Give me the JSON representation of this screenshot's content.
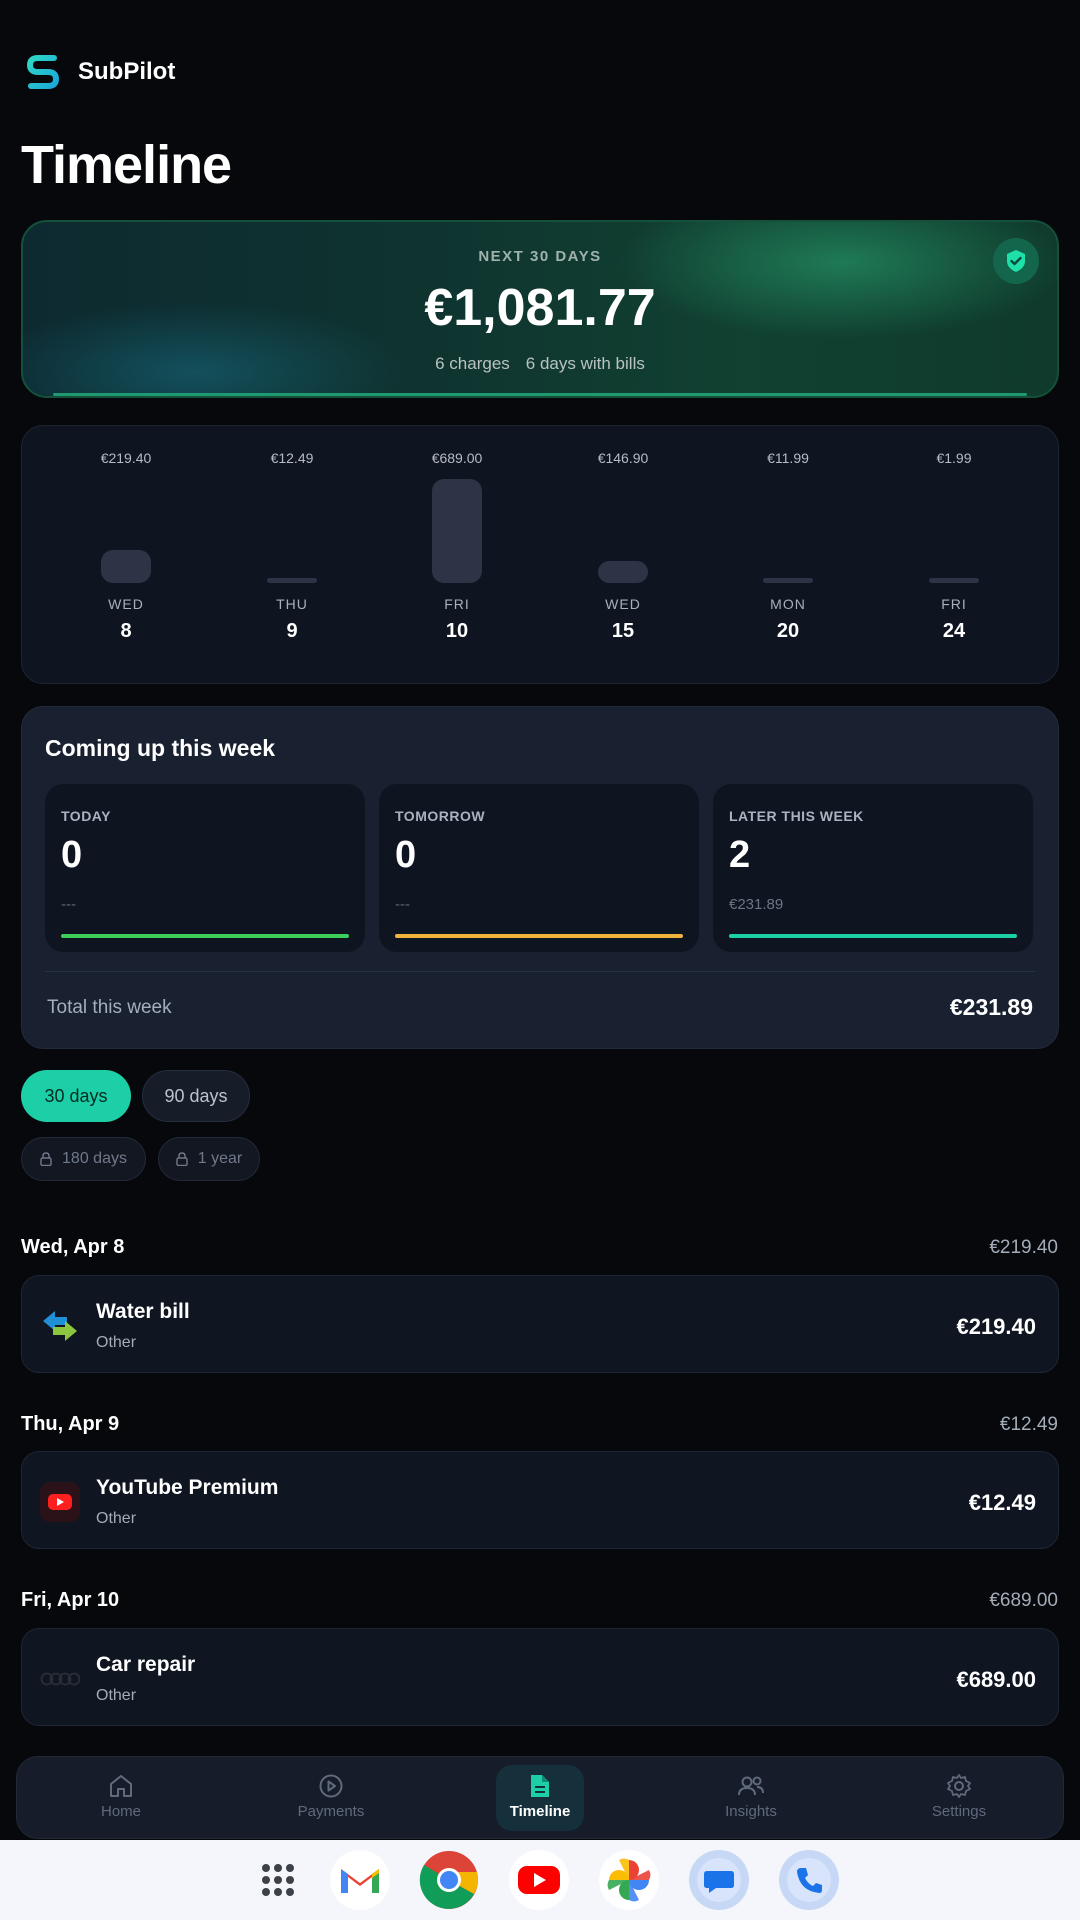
{
  "app": {
    "name": "SubPilot"
  },
  "page": {
    "title": "Timeline"
  },
  "summary": {
    "label": "NEXT 30 DAYS",
    "amount": "€1,081.77",
    "charges": "6 charges",
    "days_with_bills": "6 days with bills"
  },
  "chart_data": {
    "type": "bar",
    "categories": [
      "WED 8",
      "THU 9",
      "FRI 10",
      "WED 15",
      "MON 20",
      "FRI 24"
    ],
    "values": [
      219.4,
      12.49,
      689.0,
      146.9,
      11.99,
      1.99
    ],
    "bars": [
      {
        "label": "€219.40",
        "day": "WED",
        "date": "8",
        "value": 219.4
      },
      {
        "label": "€12.49",
        "day": "THU",
        "date": "9",
        "value": 12.49
      },
      {
        "label": "€689.00",
        "day": "FRI",
        "date": "10",
        "value": 689.0
      },
      {
        "label": "€146.90",
        "day": "WED",
        "date": "15",
        "value": 146.9
      },
      {
        "label": "€11.99",
        "day": "MON",
        "date": "20",
        "value": 11.99
      },
      {
        "label": "€1.99",
        "day": "FRI",
        "date": "24",
        "value": 1.99
      }
    ]
  },
  "week": {
    "title": "Coming up this week",
    "cards": [
      {
        "label": "TODAY",
        "count": "0",
        "sub": "---",
        "color": "#3ccf5a"
      },
      {
        "label": "TOMORROW",
        "count": "0",
        "sub": "---",
        "color": "#f0b33e"
      },
      {
        "label": "LATER THIS WEEK",
        "count": "2",
        "sub": "€231.89",
        "color": "#1ccfa6"
      }
    ],
    "total_label": "Total this week",
    "total_value": "€231.89"
  },
  "ranges": {
    "d30": "30 days",
    "d90": "90 days",
    "d180": "180 days",
    "y1": "1 year"
  },
  "groups": [
    {
      "date": "Wed, Apr 8",
      "total": "€219.40",
      "item": {
        "name": "Water bill",
        "category": "Other",
        "amount": "€219.40",
        "icon": "water-bill-icon"
      }
    },
    {
      "date": "Thu, Apr 9",
      "total": "€12.49",
      "item": {
        "name": "YouTube Premium",
        "category": "Other",
        "amount": "€12.49",
        "icon": "youtube-icon"
      }
    },
    {
      "date": "Fri, Apr 10",
      "total": "€689.00",
      "item": {
        "name": "Car repair",
        "category": "Other",
        "amount": "€689.00",
        "icon": "audi-rings-icon"
      }
    }
  ],
  "nav": {
    "home": "Home",
    "payments": "Payments",
    "timeline": "Timeline",
    "insights": "Insights",
    "settings": "Settings"
  },
  "dock": [
    "apps-grid-icon",
    "gmail-icon",
    "chrome-icon",
    "youtube-icon",
    "photos-icon",
    "messages-icon",
    "phone-icon"
  ]
}
